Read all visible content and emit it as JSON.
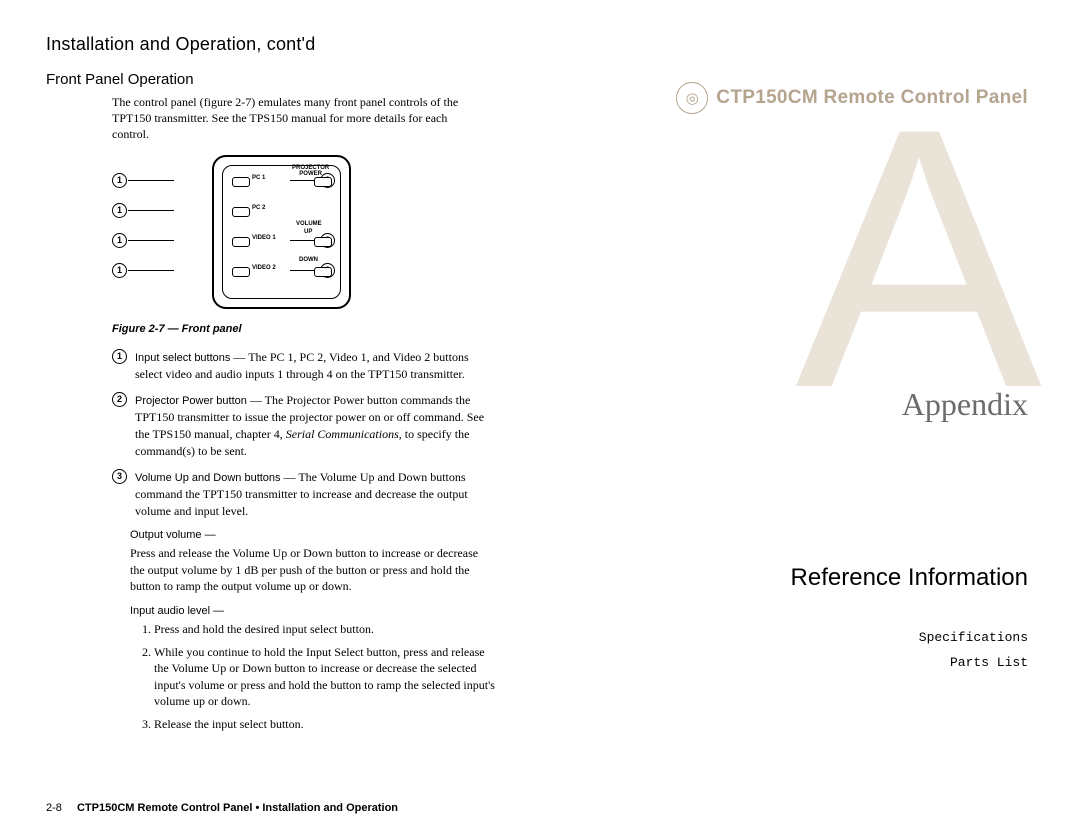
{
  "left": {
    "h1": "Installation and Operation, cont'd",
    "h2": "Front Panel Operation",
    "intro": "The control panel (figure 2-7) emulates many front panel controls of the TPT150 transmitter.  See the TPS150 manual for more details for each control.",
    "figcaption": "Figure 2-7 — Front panel",
    "panel_labels": {
      "pc1": "PC 1",
      "pc2": "PC 2",
      "vid1": "VIDEO 1",
      "vid2": "VIDEO 2",
      "projpower": "PROJECTOR\nPOWER",
      "volume": "VOLUME",
      "up": "UP",
      "down": "DOWN"
    },
    "callouts": [
      "1",
      "2",
      "3"
    ],
    "items": [
      {
        "n": "1",
        "bold": "Input select buttons",
        "rest": " — The PC 1, PC 2, Video 1, and Video 2 buttons select video and audio inputs 1 through 4 on the TPT150 transmitter."
      },
      {
        "n": "2",
        "bold": "Projector Power button",
        "rest": " — The Projector Power button commands the TPT150 transmitter to issue the projector power on or off command.  See the TPS150 manual, chapter 4, ",
        "ital": "Serial Communications",
        "rest2": ", to specify the command(s) to be sent."
      },
      {
        "n": "3",
        "bold": "Volume Up and Down buttons",
        "rest": " — The Volume Up and Down buttons command the TPT150 transmitter to increase and decrease the output volume and input level."
      }
    ],
    "outvol_label": "Output volume  —",
    "outvol_para": "Press and release the Volume Up or Down button to increase or decrease the output volume by 1 dB per push of the button or press and hold  the button to ramp the output volume up or down.",
    "inaudio_label": "Input audio level  —",
    "steps": [
      "Press and hold the desired input select button.",
      "While you continue to hold  the Input Select button, press and release the Volume Up or Down button to increase or decrease the selected input's volume or press and hold  the button to ramp the selected input's volume up or down.",
      "Release the input select button."
    ],
    "footer_page": "2-8",
    "footer_text": "CTP150CM Remote Control Panel • Installation and Operation"
  },
  "right": {
    "title": "CTP150CM Remote Control Panel",
    "bigletter": "A",
    "appendix": "Appendix",
    "refinfo": "Reference Information",
    "spec": "Specifications",
    "parts": "Parts List"
  }
}
